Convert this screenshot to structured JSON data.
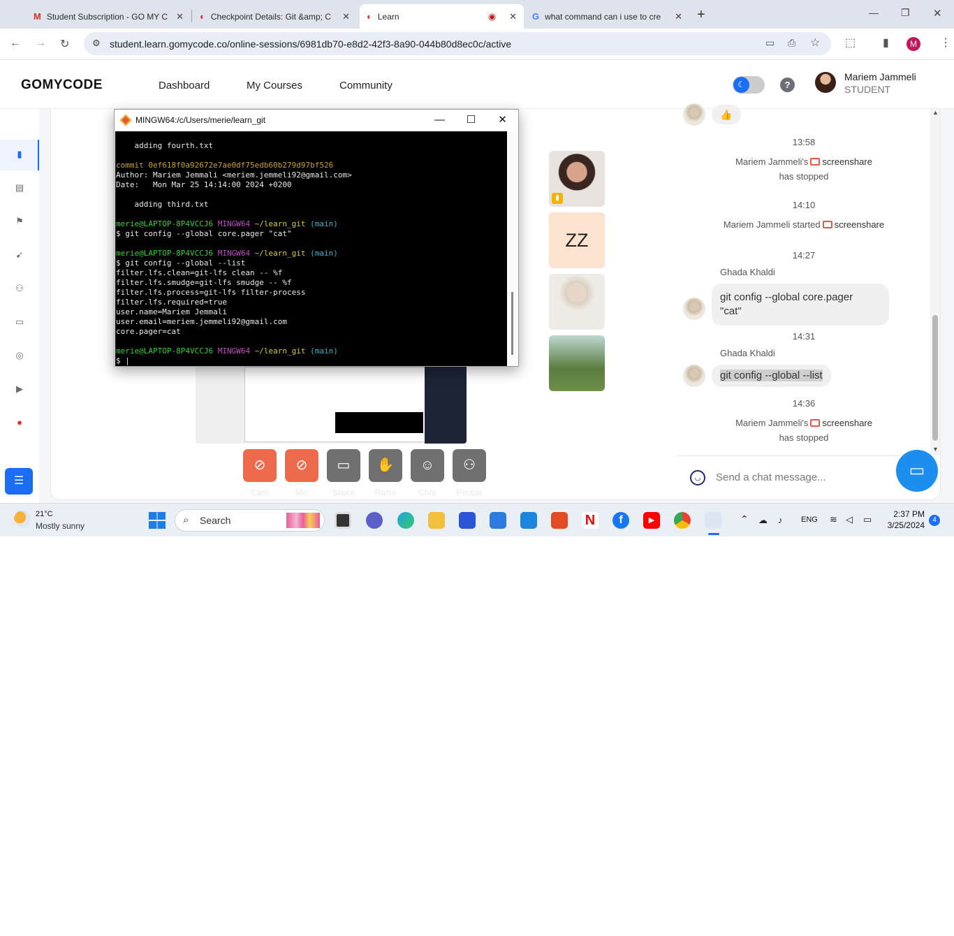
{
  "browser": {
    "tabs": [
      {
        "title": "Student Subscription - GO MY C",
        "icon": "gmail-icon"
      },
      {
        "title": "Checkpoint Details: Git &amp; C",
        "icon": "gomycode-icon"
      },
      {
        "title": "Learn",
        "icon": "gomycode-icon",
        "active": true
      },
      {
        "title": "what command can i use to cre",
        "icon": "google-icon"
      }
    ],
    "url": "student.learn.gomycode.co/online-sessions/6981db70-e8d2-42f3-8a90-044b80d8ec0c/active",
    "profile_initial": "M"
  },
  "site": {
    "logo": "GOMYCODE",
    "nav": [
      "Dashboard",
      "My Courses",
      "Community"
    ],
    "user_name": "Mariem Jammeli",
    "user_role": "STUDENT",
    "accent": "#ee6a4c",
    "primary": "#1b6ef3"
  },
  "terminal": {
    "title": "MINGW64:/c/Users/merie/learn_git",
    "line_adding_fourth": "    adding fourth.txt",
    "commit": "commit 0ef618f0a92672e7ae0df75edb60b279d97bf526",
    "author": "Author: Mariem Jemmali <meriem.jemmeli92@gmail.com>",
    "date": "Date:   Mon Mar 25 14:14:00 2024 +0200",
    "line_adding_third": "    adding third.txt",
    "prompt_user": "merie@LAPTOP-8P4VCCJ6",
    "prompt_sys": "MINGW64",
    "prompt_path": "~/learn_git",
    "prompt_branch": "(main)",
    "cmd1": "$ git config --global core.pager \"cat\"",
    "cmd2": "$ git config --global --list",
    "out1": "filter.lfs.clean=git-lfs clean -- %f",
    "out2": "filter.lfs.smudge=git-lfs smudge -- %f",
    "out3": "filter.lfs.process=git-lfs filter-process",
    "out4": "filter.lfs.required=true",
    "out5": "user.name=Mariem Jemmali",
    "out6": "user.email=meriem.jemmeli92@gmail.com",
    "out7": "core.pager=cat",
    "cmd3": "$ |"
  },
  "participants": {
    "thumb2_initials": "ZZ"
  },
  "controls": [
    {
      "label": "Cam",
      "icon": "camera-off-icon"
    },
    {
      "label": "Mic",
      "icon": "mic-off-icon"
    },
    {
      "label": "Share",
      "icon": "screen-share-icon"
    },
    {
      "label": "Raise",
      "icon": "raise-hand-icon"
    },
    {
      "label": "Chat",
      "icon": "chat-icon"
    },
    {
      "label": "People",
      "icon": "people-icon"
    }
  ],
  "chat": {
    "reaction": "👍",
    "t1": "13:58",
    "e1_user": "Mariem Jammeli's",
    "e1_word": "screenshare",
    "e1_tail": "has stopped",
    "t2": "14:10",
    "e2_user": "Mariem Jammeli started",
    "e2_word": "screenshare",
    "t3": "14:27",
    "m1_sender": "Ghada Khaldi",
    "m1_text_a": "git config --global core.pager",
    "m1_text_b": "\"cat\"",
    "t4": "14:31",
    "m2_sender": "Ghada Khaldi",
    "m2_text": "git config --global --list",
    "t5": "14:36",
    "e3_user": "Mariem Jammeli's",
    "e3_word": "screenshare",
    "e3_tail": "has stopped",
    "input_placeholder": "Send a chat message..."
  },
  "taskbar": {
    "temperature": "21°C",
    "weather": "Mostly sunny",
    "search": "Search",
    "lang": "ENG",
    "time": "2:37 PM",
    "date": "3/25/2024",
    "notifications": "4"
  }
}
